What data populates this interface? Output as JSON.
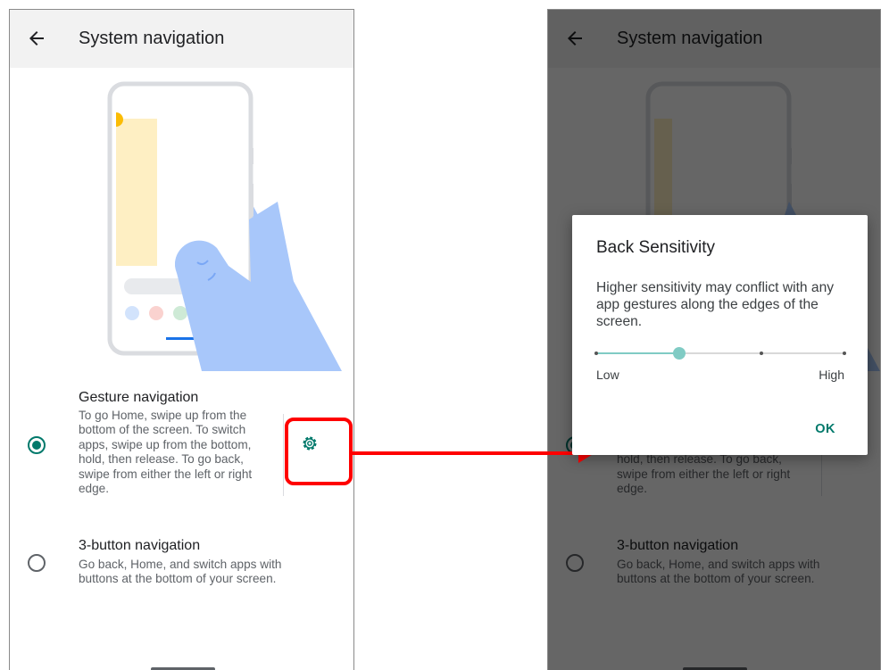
{
  "app_bar": {
    "title": "System navigation",
    "back_icon": "arrow-back-icon"
  },
  "options": [
    {
      "title": "Gesture navigation",
      "description_lines": [
        "To go Home, swipe up from the",
        "bottom of the screen. To switch",
        "apps, swipe up from the bottom,",
        "hold, then release. To go back,",
        "swipe from either the left or right",
        "edge."
      ],
      "selected": true,
      "settings_icon": "gear-icon"
    },
    {
      "title": "3-button navigation",
      "description_lines": [
        "Go back, Home, and switch apps with",
        "buttons at the bottom of your screen."
      ],
      "selected": false
    }
  ],
  "dialog": {
    "title": "Back Sensitivity",
    "message": "Higher sensitivity may conflict with any app gestures along the edges of the screen.",
    "slider": {
      "min_label": "Low",
      "max_label": "High",
      "steps": 4,
      "value_index": 1
    },
    "ok_label": "OK"
  },
  "colors": {
    "accent": "#00796b",
    "slider_active": "#80cbc4",
    "annotation": "#ff0000",
    "illustration_hand": "#a8c7fa",
    "illustration_card": "#feefc3"
  }
}
